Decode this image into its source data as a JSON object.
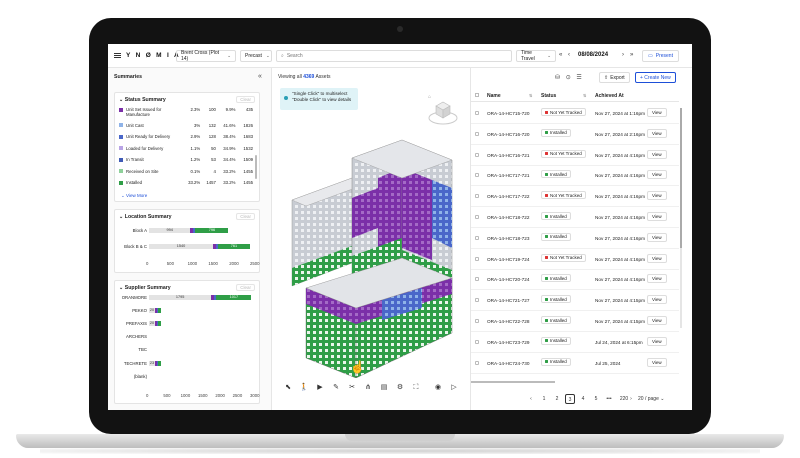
{
  "app": {
    "logo": "Y N Ø M I A",
    "project": "Brent Cross (Plot 14)",
    "mode": "Precast",
    "search_placeholder": "Search",
    "time_travel": "Time Travel",
    "date": "08/08/2024",
    "present": "Present"
  },
  "left": {
    "title": "Summaries",
    "status": {
      "title": "Status Summary",
      "clear": "Clear",
      "rows": [
        {
          "label": "Unit Set Issued for Manufacture",
          "pct": "2.3%",
          "count": "100",
          "pct2": "9.9%",
          "total": "435",
          "color": "#7b2fa8"
        },
        {
          "label": "Unit Cast",
          "pct": "3%",
          "count": "132",
          "pct2": "41.6%",
          "total": "1826",
          "color": "#8fb3e8"
        },
        {
          "label": "Unit Ready for Delivery",
          "pct": "2.9%",
          "count": "128",
          "pct2": "38.4%",
          "total": "1683",
          "color": "#4a67c9"
        },
        {
          "label": "Loaded for Delivery",
          "pct": "1.1%",
          "count": "50",
          "pct2": "34.9%",
          "total": "1532",
          "color": "#b9a4e6"
        },
        {
          "label": "In Transit",
          "pct": "1.2%",
          "count": "53",
          "pct2": "34.4%",
          "total": "1509",
          "color": "#3f5bb6"
        },
        {
          "label": "Received on Site",
          "pct": "0.1%",
          "count": "4",
          "pct2": "33.2%",
          "total": "1455",
          "color": "#8ed19a"
        },
        {
          "label": "Installed",
          "pct": "33.2%",
          "count": "1457",
          "pct2": "33.2%",
          "total": "1455",
          "color": "#2f9e47"
        }
      ],
      "view_more": "View More"
    },
    "location": {
      "title": "Location Summary",
      "clear": "Clear",
      "bars": [
        {
          "label": "Block A",
          "grey": "994",
          "green": "796"
        },
        {
          "label": "Block B & C",
          "grey": "1540",
          "green": "761"
        }
      ],
      "ticks": [
        "0",
        "500",
        "1000",
        "1500",
        "2000",
        "2500"
      ]
    },
    "supplier": {
      "title": "Supplier Summary",
      "clear": "Clear",
      "bars": [
        {
          "label": "ORANMORE",
          "grey": "1795",
          "green": "1017"
        },
        {
          "label": "PEKKO",
          "grey": "20",
          "green": ""
        },
        {
          "label": "PREFAXIS",
          "grey": "20",
          "green": ""
        },
        {
          "label": "ARCHERS",
          "grey": "",
          "green": ""
        },
        {
          "label": "TBC",
          "grey": "",
          "green": ""
        },
        {
          "label": "TECHRETE",
          "grey": "23",
          "green": ""
        },
        {
          "label": "(blank)",
          "grey": "",
          "green": ""
        }
      ],
      "ticks": [
        "0",
        "500",
        "1000",
        "1500",
        "2000",
        "2500",
        "3000"
      ]
    }
  },
  "viewer": {
    "viewing_prefix": "Viewing all",
    "viewing_count": "4369",
    "viewing_suffix": "Assets",
    "tip_line1": "\"Single Click\" to multiselect",
    "tip_line2": "\"Double Click\" to view details"
  },
  "table": {
    "export": "Export",
    "create_new": "+ Create New",
    "headers": {
      "name": "Name",
      "status": "Status",
      "achieved": "Achieved At"
    },
    "view_label": "View",
    "rows": [
      {
        "name": "ORA-14-HC715-720",
        "status": "Not Yet Tracked",
        "achieved": "Nov 27, 2024 at 1:16pm",
        "color": "#d33"
      },
      {
        "name": "ORA-14-HC716-720",
        "status": "Installed",
        "achieved": "Nov 27, 2024 at 2:16pm",
        "color": "#2f9e47"
      },
      {
        "name": "ORA-14-HC716-721",
        "status": "Not Yet Tracked",
        "achieved": "Nov 27, 2024 at 4:16pm",
        "color": "#d33"
      },
      {
        "name": "ORA-14-HC717-721",
        "status": "Installed",
        "achieved": "Nov 27, 2024 at 4:16pm",
        "color": "#2f9e47"
      },
      {
        "name": "ORA-14-HC717-722",
        "status": "Not Yet Tracked",
        "achieved": "Nov 27, 2024 at 4:16pm",
        "color": "#d33"
      },
      {
        "name": "ORA-14-HC718-722",
        "status": "Installed",
        "achieved": "Nov 27, 2024 at 4:16pm",
        "color": "#2f9e47"
      },
      {
        "name": "ORA-14-HC718-723",
        "status": "Installed",
        "achieved": "Nov 27, 2024 at 4:16pm",
        "color": "#2f9e47"
      },
      {
        "name": "ORA-14-HC719-724",
        "status": "Not Yet Tracked",
        "achieved": "Nov 27, 2024 at 4:16pm",
        "color": "#d33"
      },
      {
        "name": "ORA-14-HC720-724",
        "status": "Installed",
        "achieved": "Nov 27, 2024 at 4:16pm",
        "color": "#2f9e47"
      },
      {
        "name": "ORA-14-HC721-727",
        "status": "Installed",
        "achieved": "Nov 27, 2024 at 4:15pm",
        "color": "#2f9e47"
      },
      {
        "name": "ORA-14-HC722-728",
        "status": "Installed",
        "achieved": "Nov 27, 2024 at 4:15pm",
        "color": "#2f9e47"
      },
      {
        "name": "ORA-14-HC723-729",
        "status": "Installed",
        "achieved": "Jul 24, 2024 at 6:15pm",
        "color": "#2f9e47"
      },
      {
        "name": "ORA-14-HC724-730",
        "status": "Installed",
        "achieved": "Jul 25, 2024",
        "color": "#2f9e47"
      }
    ]
  },
  "pager": {
    "prev": "‹",
    "pages": [
      "1",
      "2",
      "3",
      "4",
      "5",
      "•••",
      "220"
    ],
    "active": "3",
    "next": "›",
    "per_page": "20 / page"
  }
}
